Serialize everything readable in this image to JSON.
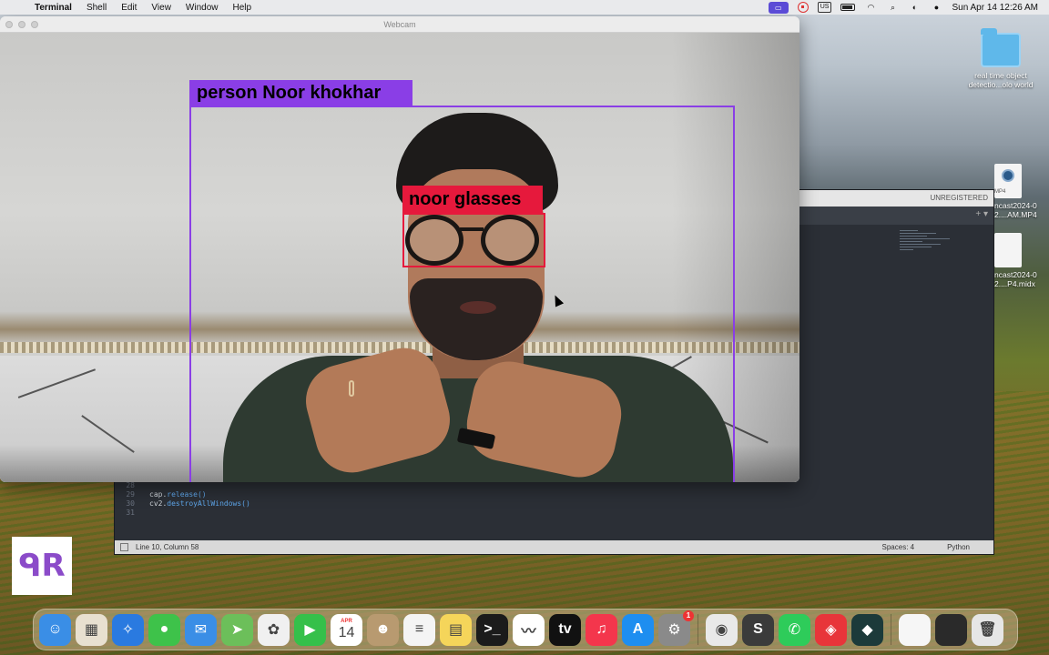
{
  "menubar": {
    "app_name": "Terminal",
    "items": [
      "Shell",
      "Edit",
      "View",
      "Window",
      "Help"
    ],
    "input_source": "US",
    "clock": "Sun Apr 14  12:26 AM"
  },
  "webcam_window": {
    "title": "Webcam",
    "detections": [
      {
        "label": "person  Noor khokhar",
        "color": "#8a3ee6"
      },
      {
        "label": "noor  glasses",
        "color": "#e6193c"
      }
    ]
  },
  "editor": {
    "titlebar_text": "UNREGISTERED",
    "tab_controls": "+ ▾",
    "code_lines": [
      {
        "num": "28",
        "text": "",
        "fn": ""
      },
      {
        "num": "29",
        "text": "cap.",
        "fn": "release()"
      },
      {
        "num": "30",
        "text": "cv2.",
        "fn": "destroyAllWindows()"
      },
      {
        "num": "31",
        "text": "",
        "fn": ""
      }
    ],
    "status": {
      "position": "Line 10, Column 58",
      "spaces": "Spaces: 4",
      "syntax": "Python"
    }
  },
  "desktop": {
    "icons": [
      {
        "name": "real time object detectio...olo world",
        "type": "folder"
      },
      {
        "name": "ncast2024-0 2....AM.MP4",
        "type": "mp4",
        "tag": "MP4"
      },
      {
        "name": "ncast2024-0 2....P4.midx",
        "type": "file"
      }
    ]
  },
  "dock": {
    "apps": [
      {
        "name": "Finder",
        "icon": "finder-icon",
        "color": "#3a8ee6",
        "glyph": "☺"
      },
      {
        "name": "Launchpad",
        "icon": "launchpad-icon",
        "color": "#e8e0d0",
        "glyph": "▦"
      },
      {
        "name": "Safari",
        "icon": "safari-icon",
        "color": "#2a7ae0",
        "glyph": "✧"
      },
      {
        "name": "Messages",
        "icon": "messages-icon",
        "color": "#3ec24a",
        "glyph": "●"
      },
      {
        "name": "Mail",
        "icon": "mail-icon",
        "color": "#3a8ee6",
        "glyph": "✉"
      },
      {
        "name": "Maps",
        "icon": "maps-icon",
        "color": "#6cbf5a",
        "glyph": "➤"
      },
      {
        "name": "Photos",
        "icon": "photos-icon",
        "color": "#f0f0f0",
        "glyph": "✿"
      },
      {
        "name": "FaceTime",
        "icon": "facetime-icon",
        "color": "#35c04a",
        "glyph": "▶"
      },
      {
        "name": "Calendar",
        "icon": "calendar-icon",
        "color": "#ffffff",
        "month": "APR",
        "day": "14"
      },
      {
        "name": "Contacts",
        "icon": "contacts-icon",
        "color": "#b89a70",
        "glyph": "☻"
      },
      {
        "name": "Reminders",
        "icon": "reminders-icon",
        "color": "#f4f4f4",
        "glyph": "≡"
      },
      {
        "name": "Notes",
        "icon": "notes-icon",
        "color": "#f5d55a",
        "glyph": "▤"
      },
      {
        "name": "Terminal",
        "icon": "terminal-icon",
        "color": "#1b1b1b",
        "glyph": ">_"
      },
      {
        "name": "Freeform",
        "icon": "freeform-icon",
        "color": "#ffffff",
        "glyph": "〰"
      },
      {
        "name": "TV",
        "icon": "tv-icon",
        "color": "#111111",
        "glyph": "tv"
      },
      {
        "name": "Music",
        "icon": "music-icon",
        "color": "#f4364c",
        "glyph": "♫"
      },
      {
        "name": "App Store",
        "icon": "appstore-icon",
        "color": "#1e8ef0",
        "glyph": "A"
      },
      {
        "name": "System Settings",
        "icon": "settings-icon",
        "color": "#8a8a8a",
        "glyph": "⚙",
        "badge": "1"
      },
      {
        "name": "Chrome",
        "icon": "chrome-icon",
        "color": "#e9e9e9",
        "glyph": "◉"
      },
      {
        "name": "Sublime Text",
        "icon": "sublime-icon",
        "color": "#3b3b3b",
        "glyph": "S"
      },
      {
        "name": "WhatsApp",
        "icon": "whatsapp-icon",
        "color": "#2ecc5a",
        "glyph": "✆"
      },
      {
        "name": "AnyDesk",
        "icon": "anydesk-icon",
        "color": "#e8353a",
        "glyph": "◈"
      },
      {
        "name": "Filmora",
        "icon": "filmora-icon",
        "color": "#1c3a3a",
        "glyph": "◆"
      },
      {
        "name": "Document",
        "icon": "document-icon",
        "color": "#f6f6f6",
        "glyph": ""
      },
      {
        "name": "Terminal Window",
        "icon": "terminal-window-icon",
        "color": "#2a2a2a",
        "glyph": ""
      },
      {
        "name": "Trash",
        "icon": "trash-icon",
        "color": "#e6e6e6",
        "glyph": "🗑"
      }
    ]
  }
}
